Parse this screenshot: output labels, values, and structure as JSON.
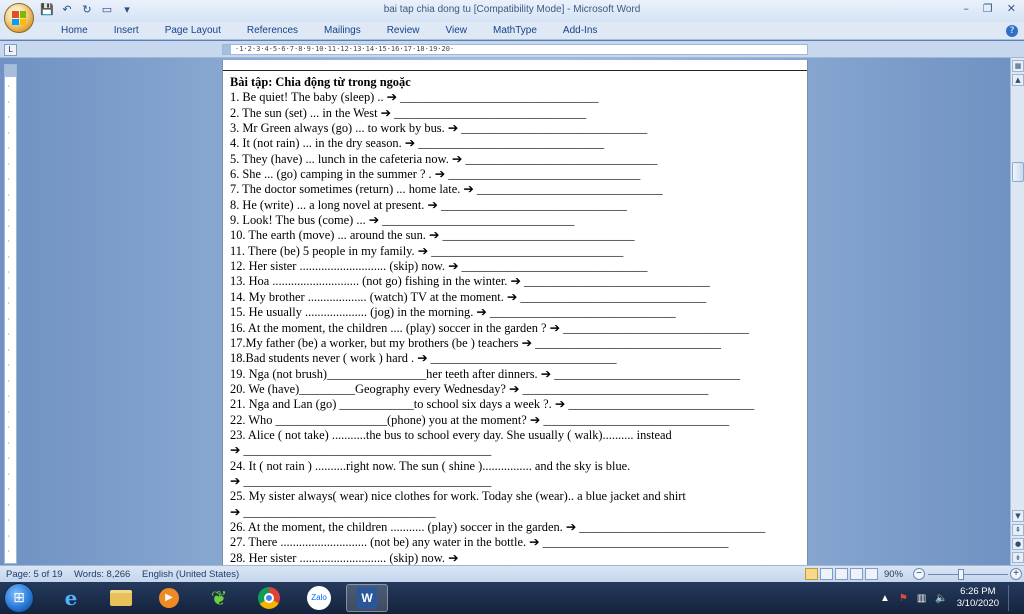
{
  "window": {
    "title": "bai tap chia dong tu [Compatibility Mode] - Microsoft Word",
    "minimize": "–",
    "restore": "❐",
    "close": "✕"
  },
  "ribbon": {
    "tabs": [
      "Home",
      "Insert",
      "Page Layout",
      "References",
      "Mailings",
      "Review",
      "View",
      "MathType",
      "Add-Ins"
    ]
  },
  "ruler": {
    "text": "·1·2·3·4·5·6·7·8·9·10·11·12·13·14·15·16·17·18·19·20·"
  },
  "document": {
    "heading": "Bài tập: Chia động từ trong ngoặc",
    "lines": [
      "1. Be quiet! The baby (sleep) .. ➔ ________________________________",
      "2. The sun (set) ... in the West ➔ _______________________________",
      "3. Mr Green always (go) ... to work by bus. ➔ ______________________________",
      "4. It (not rain) ... in the dry season. ➔ ______________________________",
      "5. They (have) ... lunch in the cafeteria now. ➔ _______________________________",
      "6. She ... (go) camping in the summer ? . ➔ _______________________________",
      "7. The doctor sometimes (return) ...  home late. ➔ ______________________________",
      "8. He (write) ... a long novel at present. ➔ ______________________________",
      "9. Look! The bus (come) ... ➔ _______________________________",
      "10. The earth (move) ... around the sun. ➔ _______________________________",
      "11. There (be) 5 people in my family. ➔ _______________________________",
      "12. Her sister ............................  (skip) now. ➔ ______________________________",
      "13. Hoa ............................  (not go) fishing in the winter. ➔ ______________________________",
      "14. My brother ...................  (watch) TV at the moment. ➔ ______________________________",
      "15. He usually ....................  (jog) in the morning. ➔ ______________________________",
      "16. At the moment, the children .... (play) soccer in the garden ?  ➔ ______________________________",
      "17.My father (be) a worker, but my brothers (be ) teachers ➔ ______________________________",
      "18.Bad students never ( work ) hard . ➔ ______________________________",
      "19. Nga (not brush)________________her teeth after dinners. ➔ ______________________________",
      "20. We (have)_________Geography every Wednesday? ➔ ______________________________",
      "21. Nga and Lan (go) ____________to school six days a week ?. ➔ ______________________________",
      "22. Who __________________(phone) you at the moment? ➔ ______________________________",
      "23. Alice ( not take) ...........the bus to school every day. She usually ( walk).......... instead",
      "➔ ________________________________________",
      "24. It ( not rain ) ..........right now. The sun ( shine )................ and the sky is blue.",
      "➔ ________________________________________",
      "25. My sister always( wear) nice clothes for work. Today she (wear).. a blue jacket and shirt",
      "➔ _______________________________",
      "26. At the moment, the children ........... (play) soccer in the garden. ➔ ______________________________",
      "27. There ............................  (not be) any water in the bottle. ➔ ______________________________",
      "28. Her sister ............................  (skip) now. ➔"
    ]
  },
  "status": {
    "page": "Page: 5 of 19",
    "words": "Words: 8,266",
    "language": "English (United States)",
    "zoom": "90%",
    "zoom_level_percent": 90
  },
  "taskbar": {
    "apps": [
      "start",
      "internet-explorer",
      "file-explorer",
      "media-player",
      "green-app",
      "chrome",
      "zalo",
      "word"
    ],
    "zalo_label": "Zalo",
    "word_label": "W",
    "time": "6:26 PM",
    "date": "3/10/2020"
  },
  "colors": {
    "ribbon_text": "#15428b",
    "workarea": "#a3bde0",
    "taskbar": "#14233d"
  }
}
